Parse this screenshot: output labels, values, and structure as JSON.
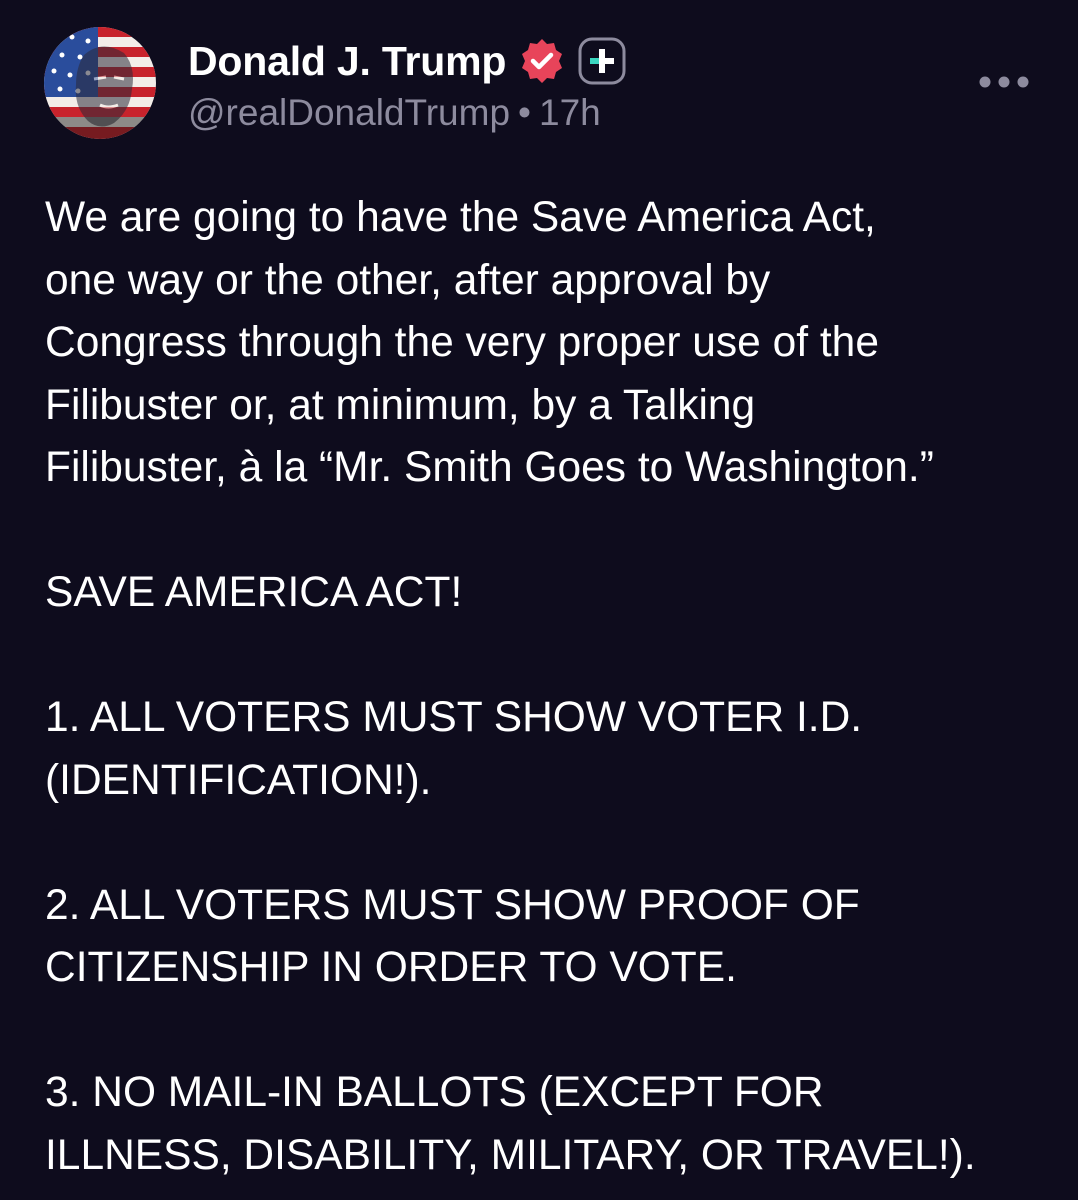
{
  "post": {
    "author": {
      "display_name": "Donald J. Trump",
      "handle": "@realDonaldTrump",
      "verified_icon": "verified-badge-icon",
      "plus_icon": "plus-badge-icon",
      "avatar_icon": "avatar-image"
    },
    "meta": {
      "separator": "•",
      "time": "17h"
    },
    "more_icon": "more-options-icon",
    "colors": {
      "background": "#0e0c1d",
      "text": "#ffffff",
      "secondary_text": "#8d8b9e",
      "verified_badge": "#e8445a",
      "plus_badge": "#3ad6c0"
    },
    "body": {
      "p1": "We are going to have the Save America Act,\none way or the other, after approval by\nCongress through the very proper use of the\nFilibuster or, at minimum, by a Talking\nFilibuster, à la “Mr. Smith Goes to Washington.”",
      "p2": "SAVE AMERICA ACT!",
      "p3": "1. ALL VOTERS MUST SHOW VOTER I.D.\n(IDENTIFICATION!).",
      "p4": "2. ALL VOTERS MUST SHOW PROOF OF\nCITIZENSHIP IN ORDER TO VOTE.",
      "p5": "3. NO MAIL-IN BALLOTS (EXCEPT FOR\nILLNESS, DISABILITY, MILITARY, OR TRAVEL!)."
    }
  }
}
